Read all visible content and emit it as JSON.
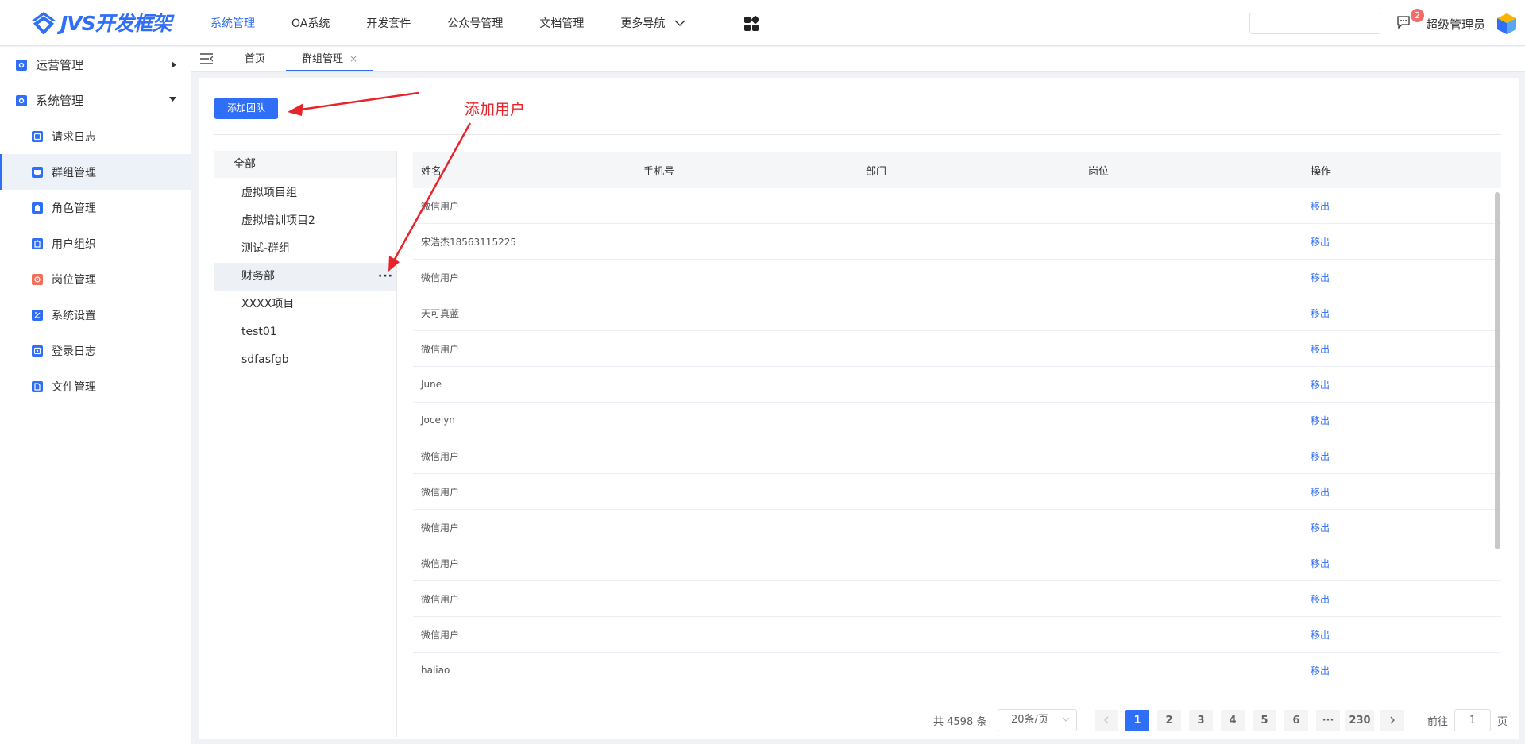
{
  "header": {
    "logo_text": "JVS开发框架",
    "nav": [
      {
        "label": "系统管理",
        "active": true
      },
      {
        "label": "OA系统"
      },
      {
        "label": "开发套件"
      },
      {
        "label": "公众号管理"
      },
      {
        "label": "文档管理"
      },
      {
        "label": "更多导航"
      }
    ],
    "search_value": "",
    "message_count": "2",
    "user_name": "超级管理员",
    "accent": "#2f6ef7"
  },
  "sidebar": {
    "groups": [
      {
        "label": "运营管理",
        "icon": "gear-icon",
        "expanded": false
      },
      {
        "label": "系统管理",
        "icon": "gear-icon",
        "expanded": true
      }
    ],
    "items": [
      {
        "label": "请求日志",
        "icon": "log-icon"
      },
      {
        "label": "群组管理",
        "icon": "group-icon",
        "active": true
      },
      {
        "label": "角色管理",
        "icon": "role-icon"
      },
      {
        "label": "用户组织",
        "icon": "org-icon"
      },
      {
        "label": "岗位管理",
        "icon": "post-icon"
      },
      {
        "label": "系统设置",
        "icon": "settings-icon"
      },
      {
        "label": "登录日志",
        "icon": "login-log-icon"
      },
      {
        "label": "文件管理",
        "icon": "file-icon"
      }
    ]
  },
  "tabs": {
    "home": "首页",
    "active": "群组管理",
    "close": "×"
  },
  "toolbar": {
    "add_team_label": "添加团队"
  },
  "tree": {
    "root": "全部",
    "nodes": [
      "虚拟项目组",
      "虚拟培训项目2",
      "测试-群组",
      "财务部",
      "XXXX项目",
      "test01",
      "sdfasfgb"
    ],
    "more": "···"
  },
  "table": {
    "columns": [
      "姓名",
      "手机号",
      "部门",
      "岗位",
      "操作"
    ],
    "action_label": "移出",
    "rows": [
      {
        "name": "微信用户"
      },
      {
        "name": "宋浩杰18563115225"
      },
      {
        "name": "微信用户"
      },
      {
        "name": "天可真蓝"
      },
      {
        "name": "微信用户"
      },
      {
        "name": "June"
      },
      {
        "name": "Jocelyn"
      },
      {
        "name": "微信用户"
      },
      {
        "name": "微信用户"
      },
      {
        "name": "微信用户"
      },
      {
        "name": "微信用户"
      },
      {
        "name": "微信用户"
      },
      {
        "name": "微信用户"
      },
      {
        "name": "haliao"
      }
    ]
  },
  "pagination": {
    "total": "共 4598 条",
    "page_size": "20条/页",
    "pages": [
      "1",
      "2",
      "3",
      "4",
      "5",
      "6"
    ],
    "ellipsis": "···",
    "last_page": "230",
    "current": "1",
    "goto_prefix": "前往",
    "goto_value": "1",
    "goto_suffix": "页"
  },
  "annotation": {
    "text": "添加用户",
    "color": "#e8242b"
  }
}
